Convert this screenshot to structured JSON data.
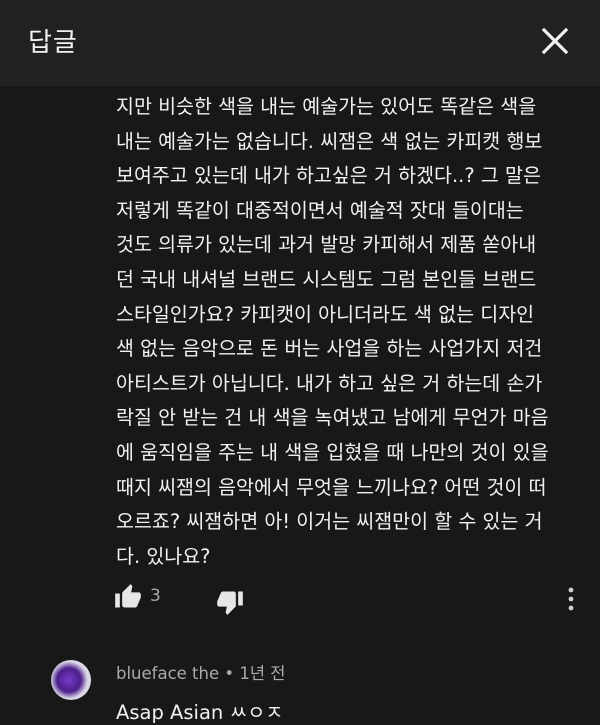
{
  "header": {
    "title": "답글",
    "close_icon": "close-icon"
  },
  "comment": {
    "lines": [
      "지만 비슷한 색을 내는 예술가는 있어도 똑같은 색을",
      "내는 예술가는 없습니다. 씨잼은 색 없는 카피캣 행보",
      "보여주고 있는데 내가 하고싶은 거 하겠다..? 그 말은",
      "저렇게 똑같이 대중적이면서 예술적 잣대 들이대는",
      "것도 의류가 있는데 과거 발망 카피해서 제품 쏟아내",
      "던 국내 내셔널 브랜드 시스템도 그럼 본인들 브랜드",
      "스타일인가요? 카피캣이 아니더라도 색 없는 디자인",
      "색 없는 음악으로 돈 버는 사업을 하는 사업가지 저건",
      "아티스트가 아닙니다. 내가 하고 싶은 거 하는데 손가",
      "락질 안 받는 건 내 색을 녹여냈고 남에게 무언가 마음",
      "에 움직임을 주는 내 색을 입혔을 때 나만의 것이 있을",
      "때지 씨잼의 음악에서 무엇을 느끼나요? 어떤 것이 떠",
      "오르죠? 씨잼하면 아! 이거는 씨잼만이 할 수 있는 거",
      "다. 있나요?"
    ],
    "like_count": "3",
    "like_icon": "thumbs-up-icon",
    "dislike_icon": "thumbs-down-icon",
    "more_icon": "more-vertical-icon"
  },
  "reply": {
    "author": "blueface the",
    "separator": "•",
    "time": "1년 전",
    "text": "Asap Asian ㅆㅇㅈ"
  },
  "colors": {
    "background": "#181818",
    "header_bg": "#212121",
    "text_primary": "#f1f1f1",
    "text_secondary": "#aaaaaa"
  }
}
